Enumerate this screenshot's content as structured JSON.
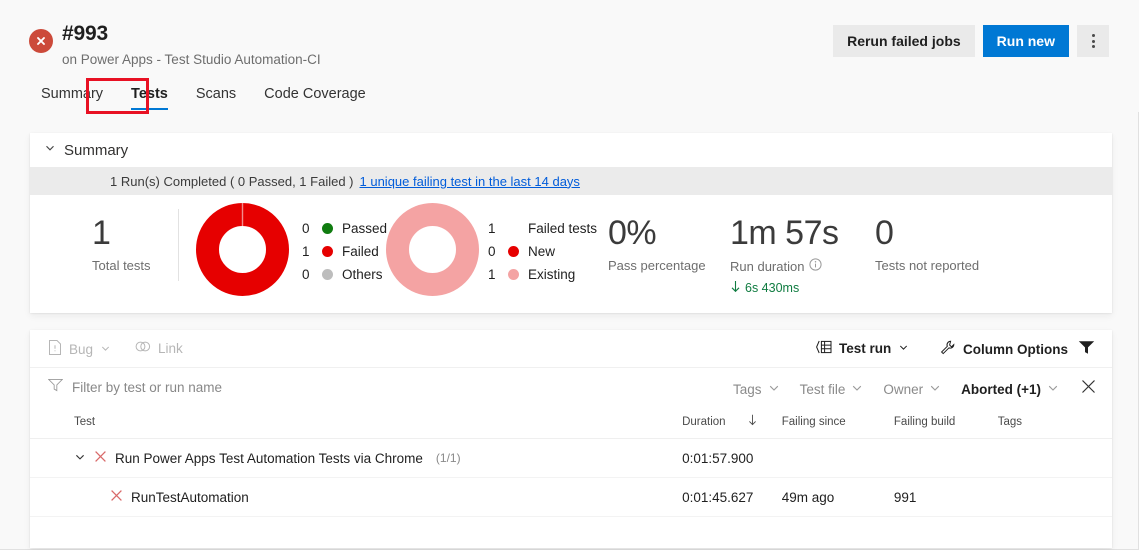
{
  "header": {
    "status_icon": "error-circle-icon",
    "build_number": "#993",
    "subtitle": "on Power Apps - Test Studio Automation-CI",
    "actions": {
      "rerun_failed_jobs": "Rerun failed jobs",
      "run_new": "Run new",
      "more": "more-actions-icon"
    }
  },
  "tabs": [
    {
      "label": "Summary",
      "active": false
    },
    {
      "label": "Tests",
      "active": true
    },
    {
      "label": "Scans",
      "active": false
    },
    {
      "label": "Code Coverage",
      "active": false
    }
  ],
  "summary": {
    "section_title": "Summary",
    "banner_text": "1 Run(s) Completed ( 0 Passed, 1 Failed )",
    "banner_link": "1 unique failing test in the last 14 days",
    "total": {
      "value": "1",
      "label": "Total tests"
    },
    "outcome_chart": {
      "legend": [
        {
          "count": "0",
          "label": "Passed",
          "color": "#107c10"
        },
        {
          "count": "1",
          "label": "Failed",
          "color": "#e60000"
        },
        {
          "count": "0",
          "label": "Others",
          "color": "#bdbdbd"
        }
      ]
    },
    "failed_chart": {
      "legend": [
        {
          "count": "1",
          "label": "Failed tests",
          "color": ""
        },
        {
          "count": "0",
          "label": "New",
          "color": "#e60000"
        },
        {
          "count": "1",
          "label": "Existing",
          "color": "#f4a3a3"
        }
      ]
    },
    "pass_percentage": {
      "value": "0%",
      "label": "Pass percentage"
    },
    "run_duration": {
      "value": "1m 57s",
      "label": "Run duration",
      "info_icon": "info-icon",
      "delta": "6s 430ms",
      "delta_icon": "arrow-down-icon"
    },
    "not_reported": {
      "value": "0",
      "label": "Tests not reported"
    }
  },
  "grid_toolbar": {
    "bug": "Bug",
    "link": "Link",
    "test_run": "Test run",
    "column_options": "Column Options",
    "filter_icon": "funnel-filter-icon"
  },
  "filter_bar": {
    "placeholder": "Filter by test or run name",
    "pills": [
      {
        "label": "Tags",
        "active": false
      },
      {
        "label": "Test file",
        "active": false
      },
      {
        "label": "Owner",
        "active": false
      },
      {
        "label": "Aborted (+1)",
        "active": true
      }
    ],
    "clear_icon": "close-icon"
  },
  "table": {
    "columns": [
      {
        "key": "test",
        "label": "Test"
      },
      {
        "key": "duration",
        "label": "Duration",
        "sort_icon": "arrow-down-icon"
      },
      {
        "key": "failing_since",
        "label": "Failing since"
      },
      {
        "key": "failing_build",
        "label": "Failing build"
      },
      {
        "key": "tags",
        "label": "Tags"
      }
    ],
    "rows": [
      {
        "level": "group",
        "expanded": true,
        "status_icon": "failed-x-icon",
        "test": "Run Power Apps Test Automation Tests via Chrome",
        "count": "(1/1)",
        "duration": "0:01:57.900",
        "failing_since": "",
        "failing_build": "",
        "tags": ""
      },
      {
        "level": "child",
        "status_icon": "failed-x-icon",
        "test": "RunTestAutomation",
        "count": "",
        "duration": "0:01:45.627",
        "failing_since": "49m ago",
        "failing_build": "991",
        "tags": ""
      }
    ]
  },
  "colors": {
    "accent": "#0078d4",
    "failed_red": "#e60000",
    "existing_pink": "#f4a3a3",
    "passed_green": "#107c10",
    "highlight_box": "#e81123"
  }
}
